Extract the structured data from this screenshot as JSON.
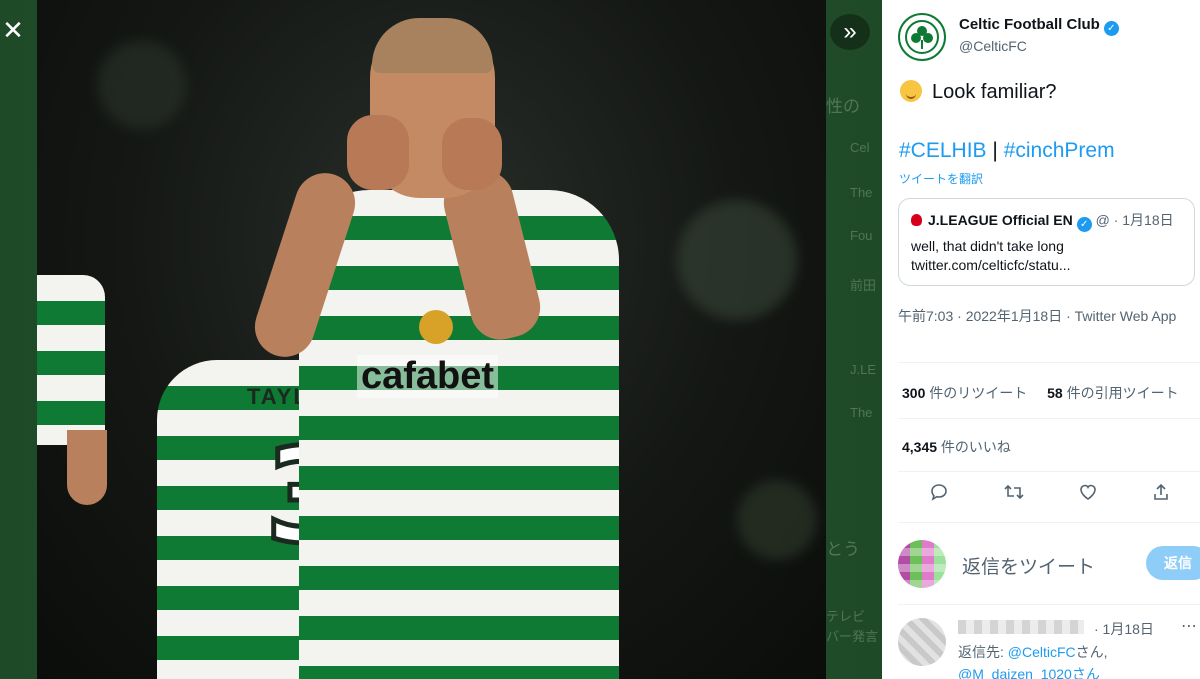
{
  "viewer": {
    "close_icon": "close-icon",
    "next_icon": "double-chevron-right-icon",
    "photo": {
      "sponsor_text": "cafabet",
      "shirt_number": "3",
      "name_on_shirt": "TAYLOR"
    },
    "background_hints": [
      "性の",
      "Cel",
      "The",
      "Fou",
      "前田",
      "J.LE",
      "The",
      "とう",
      "テレビ",
      "バー発言"
    ]
  },
  "tweet": {
    "account": {
      "name": "Celtic Football Club",
      "handle": "@CelticFC",
      "verified": true
    },
    "text": "Look familiar?",
    "emoji": "smirk-emoji",
    "hashtag_1": "#CELHIB",
    "separator": "|",
    "hashtag_2": "#cinchPrem",
    "translate_label": "ツイートを翻訳",
    "quote": {
      "name": "J.LEAGUE Official EN",
      "handle_short": "@",
      "date": "1月18日",
      "line1": "well, that didn't take long",
      "line2": "twitter.com/celticfc/statu..."
    },
    "meta": "午前7:03 · 2022年1月18日 · Twitter Web App",
    "stats": {
      "retweets_count": "300",
      "retweets_label": " 件のリツイート",
      "quotes_count": "58",
      "quotes_label": " 件の引用ツイート",
      "likes_count": "4,345",
      "likes_label": " 件のいいね"
    },
    "actions": [
      "reply-icon",
      "retweet-icon",
      "like-icon",
      "share-icon"
    ],
    "compose": {
      "placeholder": "返信をツイート",
      "button": "返信"
    },
    "reply": {
      "date": "· 1月18日",
      "to_prefix": "返信先: ",
      "to_link": "@CelticFC",
      "to_suffix": "さん,",
      "to_line2": "@M_daizen_1020さん"
    }
  },
  "colors": {
    "accent": "#1d9bf0",
    "celtic_green": "#0e7a34",
    "text_secondary": "#536471"
  }
}
